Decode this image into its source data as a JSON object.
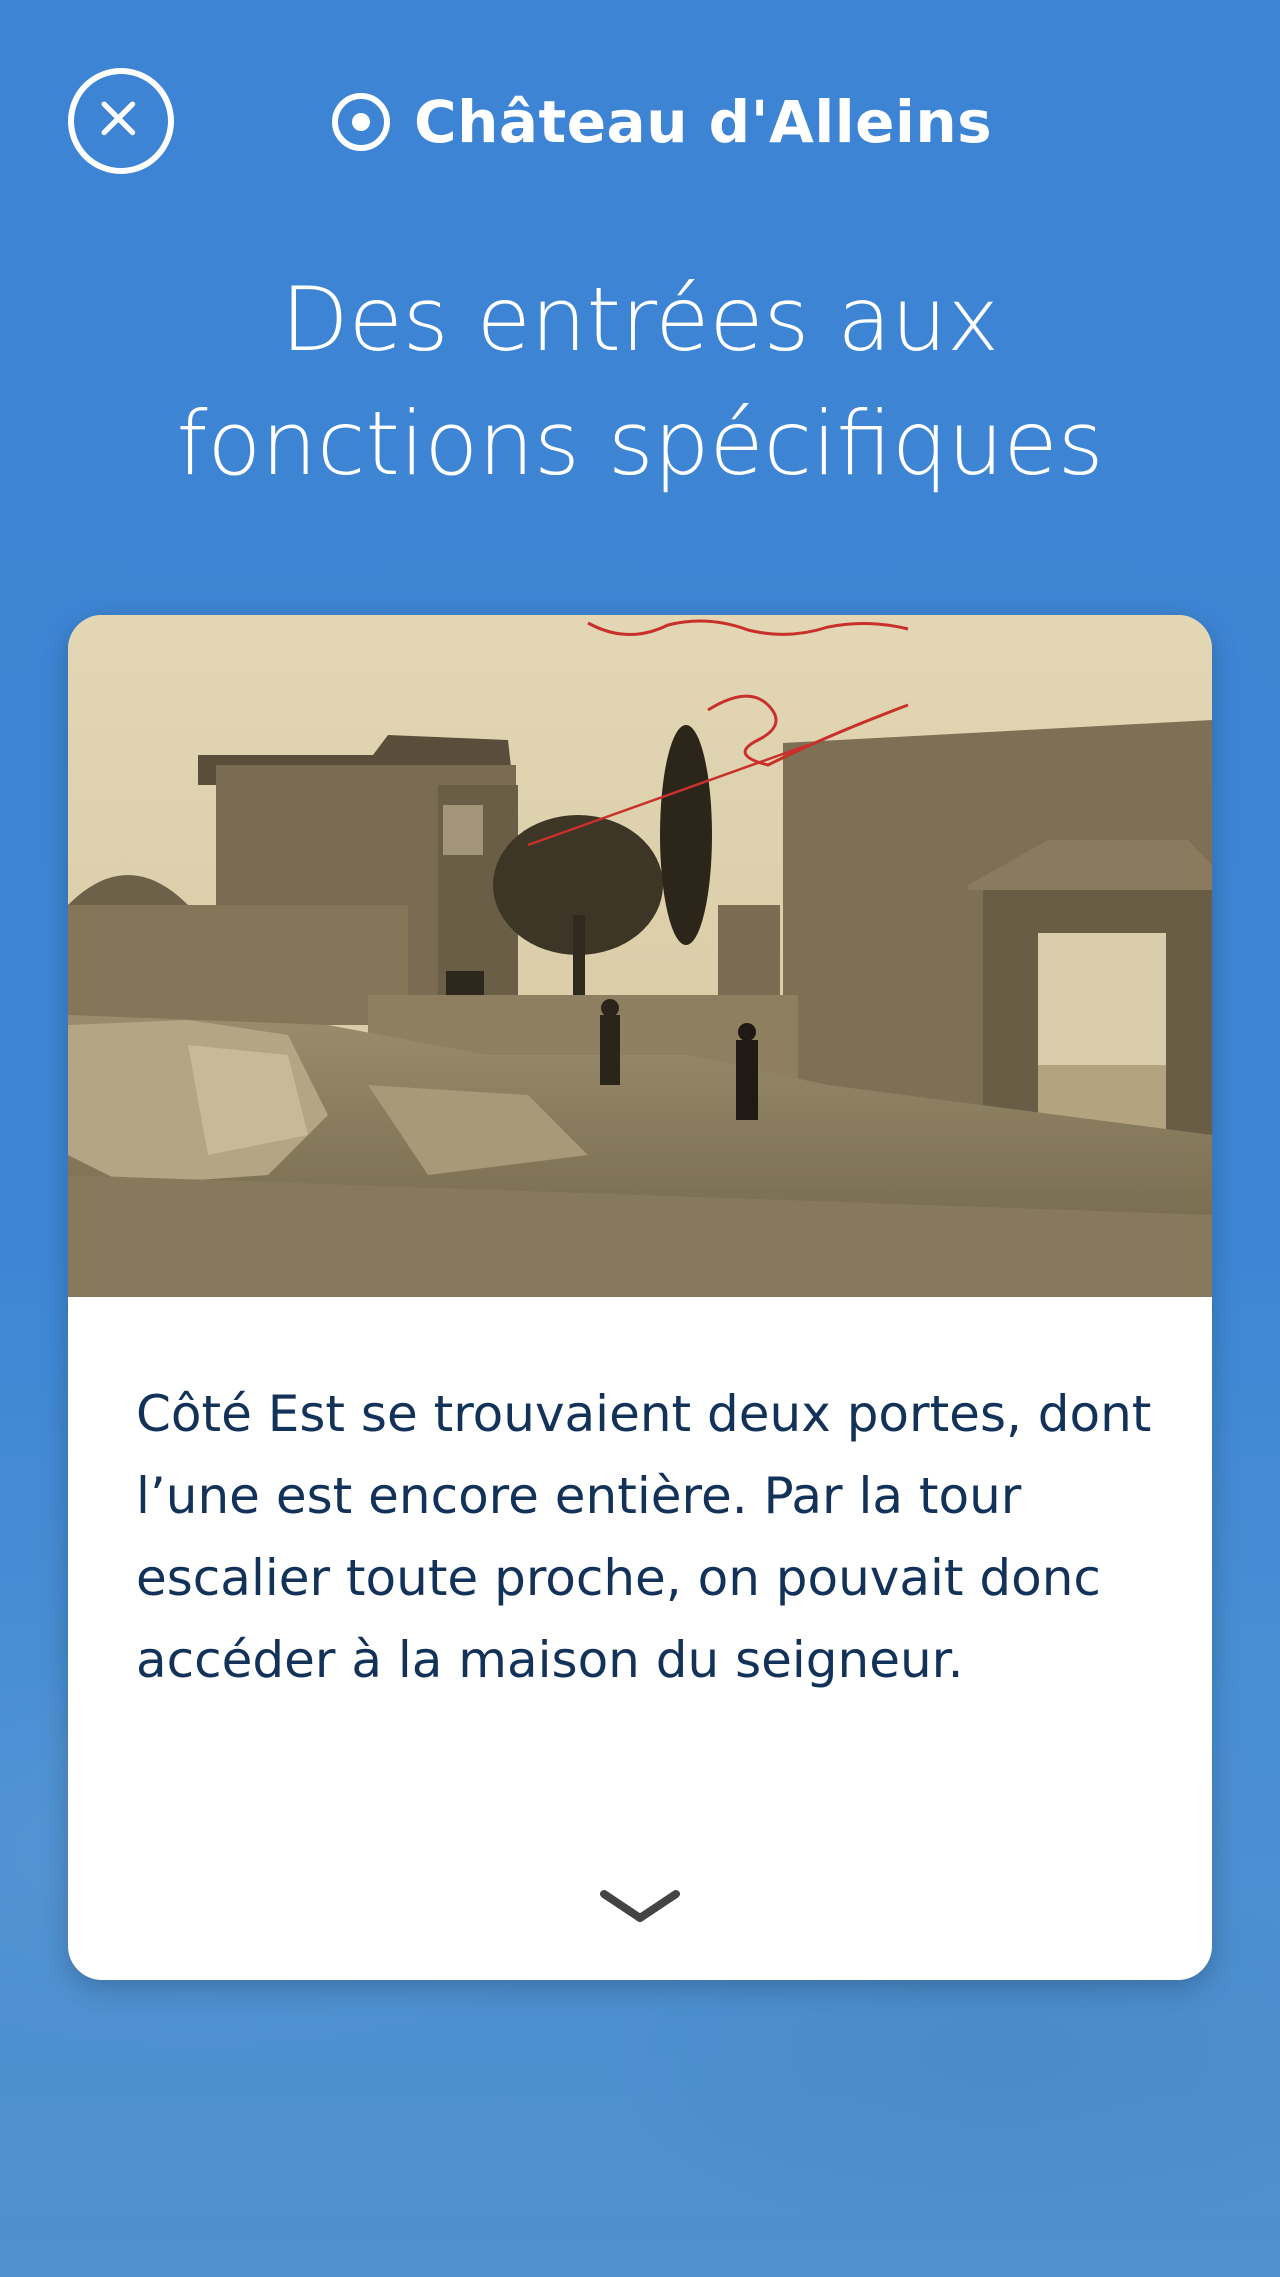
{
  "header": {
    "close_icon": "close-circle-icon",
    "location_icon": "target-icon",
    "title": "Château d'Alleins"
  },
  "page": {
    "title_line1": "Des entrées aux",
    "title_line2": "fonctions spécifiques"
  },
  "card": {
    "photo_description_icon": "historic-postcard-photo",
    "body_text": "Côté Est se trouvaient deux portes, dont l’une est encore entière. Par la tour escalier toute proche, on pouvait donc accéder à la maison du seigneur.",
    "expand_icon": "chevron-down-icon"
  },
  "colors": {
    "background": "#3e86d5",
    "card_text": "#13325a",
    "card_bg": "#ffffff",
    "chevron": "#444444"
  }
}
